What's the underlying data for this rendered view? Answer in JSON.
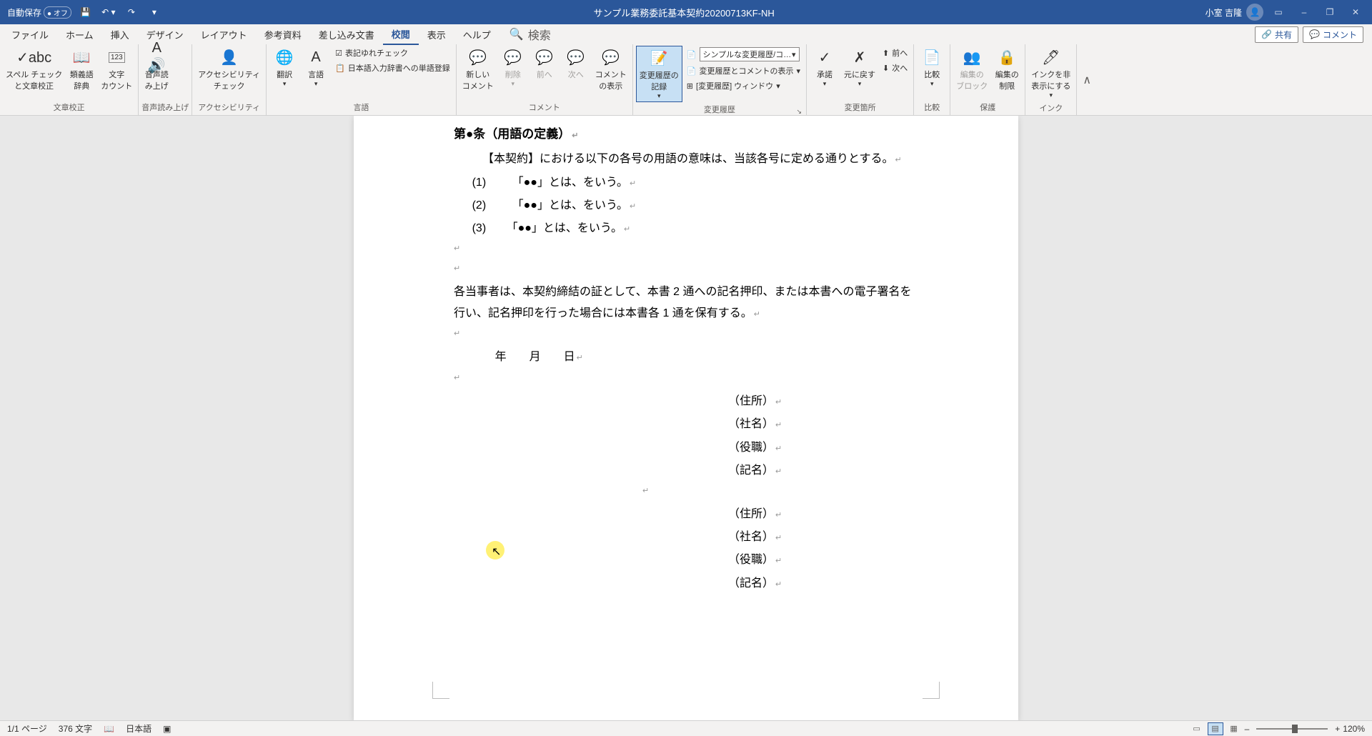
{
  "titlebar": {
    "autosave_label": "自動保存",
    "autosave_state": "オフ",
    "doc_title": "サンプル業務委託基本契約20200713KF-NH",
    "user_name": "小室 吉隆"
  },
  "tabs": {
    "file": "ファイル",
    "home": "ホーム",
    "insert": "挿入",
    "design": "デザイン",
    "layout": "レイアウト",
    "references": "参考資料",
    "mailings": "差し込み文書",
    "review": "校閲",
    "view": "表示",
    "help": "ヘルプ",
    "search": "検索",
    "share": "共有",
    "comment": "コメント"
  },
  "ribbon": {
    "spelling": "スペル チェック\nと文章校正",
    "thesaurus": "類義語\n辞典",
    "word_count": "文字\nカウント",
    "proofing_label": "文章校正",
    "read_aloud": "音声読\nみ上げ",
    "read_aloud_label": "音声読み上げ",
    "accessibility": "アクセシビリティ\nチェック",
    "accessibility_label": "アクセシビリティ",
    "translate": "翻訳",
    "language": "言語",
    "notation_check": "表記ゆれチェック",
    "dict_register": "日本語入力辞書への単語登録",
    "language_label": "言語",
    "new_comment": "新しい\nコメント",
    "delete": "削除",
    "previous": "前へ",
    "next": "次へ",
    "show_comments": "コメント\nの表示",
    "comments_label": "コメント",
    "track_changes": "変更履歴の\n記録",
    "track_dropdown": "シンプルな変更履歴/コ…",
    "show_changes": "変更履歴とコメントの表示",
    "window_changes": "[変更履歴] ウィンドウ",
    "tracking_label": "変更履歴",
    "accept": "承諾",
    "reject": "元に戻す",
    "prev_change": "前へ",
    "next_change": "次へ",
    "changes_label": "変更箇所",
    "compare": "比較",
    "compare_label": "比較",
    "block_edit": "編集の\nブロック",
    "restrict_edit": "編集の\n制限",
    "protect_label": "保護",
    "hide_ink": "インクを非\n表示にする",
    "ink_label": "インク"
  },
  "document": {
    "heading": "第●条（用語の定義）",
    "intro": "【本契約】における以下の各号の用語の意味は、当該各号に定める通りとする。",
    "item1_num": "(1)",
    "item1_text": "「●●」とは、をいう。",
    "item2_num": "(2)",
    "item2_text": "「●●」とは、をいう。",
    "item3_num": "(3)",
    "item3_text": "「●●」とは、をいう。",
    "body": "各当事者は、本契約締結の証として、本書 2 通への記名押印、または本書への電子署名を行い、記名押印を行った場合には本書各 1 通を保有する。",
    "date": "　　年　　月　　日",
    "sig1_addr": "（住所）",
    "sig1_company": "（社名）",
    "sig1_title": "（役職）",
    "sig1_name": "（記名）",
    "sig2_addr": "（住所）",
    "sig2_company": "（社名）",
    "sig2_title": "（役職）",
    "sig2_name": "（記名）"
  },
  "statusbar": {
    "page": "1/1 ページ",
    "words": "376 文字",
    "language": "日本語",
    "zoom": "120%"
  }
}
